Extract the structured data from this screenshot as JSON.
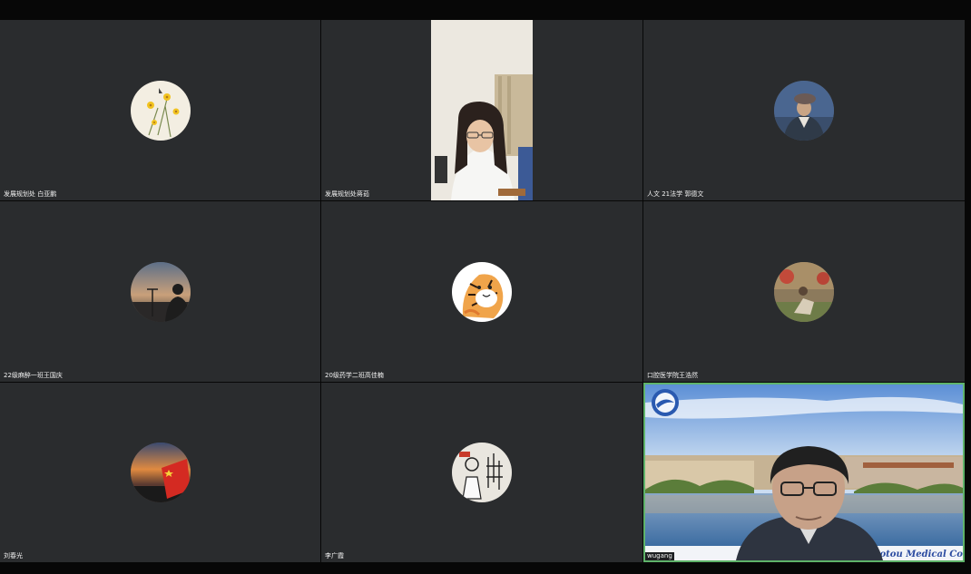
{
  "participants": [
    {
      "name": "发展规划处 白亚鹏",
      "avatar_icon": "flower-avatar-icon"
    },
    {
      "name": "发展规划处蒋茹",
      "video": "video-feed-woman-glasses"
    },
    {
      "name": "人文 21法学 郭德文",
      "avatar_icon": "person-cap-avatar-icon"
    },
    {
      "name": "22级麻醉一班王国庆",
      "avatar_icon": "sunset-silhouette-avatar-icon"
    },
    {
      "name": "20级药学二班高佳楠",
      "avatar_icon": "tiger-cartoon-avatar-icon"
    },
    {
      "name": "口腔医学院王浩然",
      "avatar_icon": "sitting-person-avatar-icon"
    },
    {
      "name": "刘春光",
      "avatar_icon": "flag-sunset-avatar-icon"
    },
    {
      "name": "李广霞",
      "avatar_icon": "calligraphy-cartoon-avatar-icon"
    },
    {
      "name": "wugang",
      "video": "video-feed-man-virtual-background",
      "background_caption": "aotou Medical College"
    }
  ],
  "colors": {
    "tile_bg": "#2a2c2e",
    "frame_bg": "#070707",
    "active_speaker_border": "#5fb36a"
  }
}
